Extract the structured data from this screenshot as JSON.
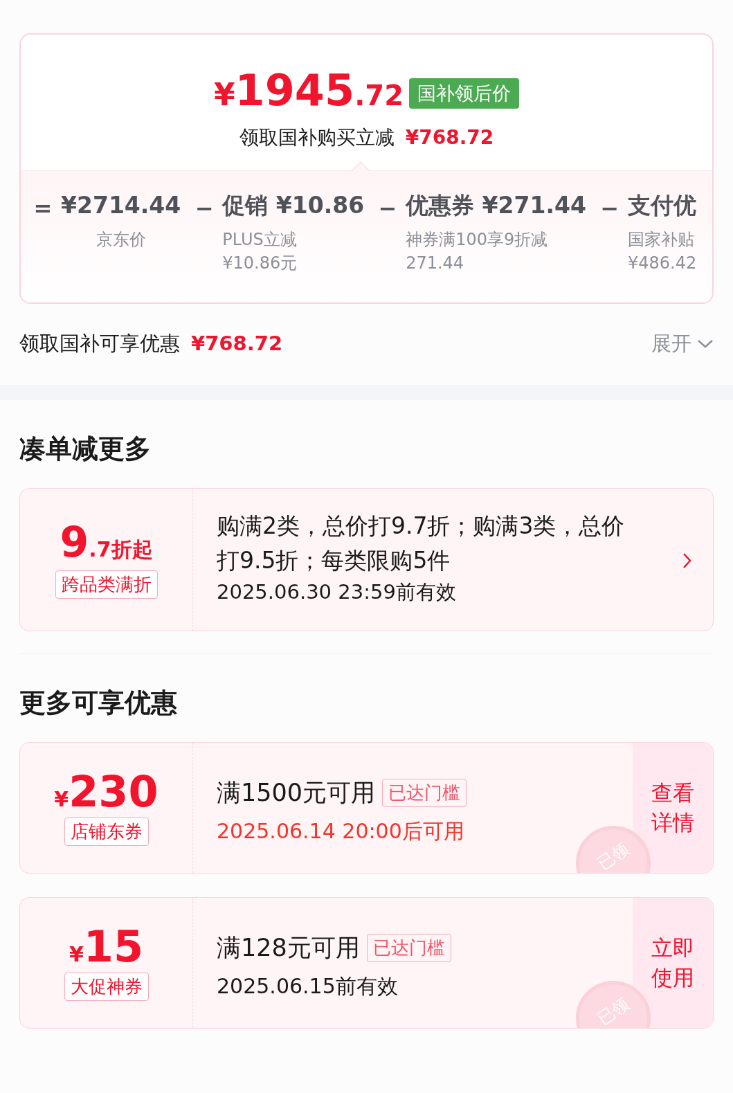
{
  "price_card": {
    "price_currency": "¥",
    "price_main": "1945",
    "price_decimal": ".72",
    "price_tag": "国补领后价",
    "savings_label": "领取国补购买立减",
    "savings_amount": "¥768.72",
    "breakdown": [
      {
        "operator": "=",
        "amount": "¥2714.44",
        "note_lines": [
          "京东价"
        ]
      },
      {
        "operator": "−",
        "amount": "促销 ¥10.86",
        "note_lines": [
          "PLUS立减",
          "¥10.86元"
        ]
      },
      {
        "operator": "−",
        "amount": "优惠券 ¥271.44",
        "note_lines": [
          "神券满100享9折减",
          "271.44"
        ]
      },
      {
        "operator": "−",
        "amount": "支付优",
        "note_lines": [
          "国家补贴",
          "¥486.42"
        ]
      }
    ]
  },
  "summary": {
    "label": "领取国补可享优惠",
    "amount": "¥768.72",
    "toggle": "展开",
    "expanded": false
  },
  "bundle_section": {
    "title": "凑单减更多",
    "offer": {
      "value_main": "9",
      "value_rest": ".7折起",
      "tag": "跨品类满折",
      "description": "购满2类，总价打9.7折；购满3类，总价打9.5折；每类限购5件",
      "validity": "2025.06.30 23:59前有效"
    }
  },
  "more_section": {
    "title": "更多可享优惠",
    "coupons": [
      {
        "currency": "¥",
        "amount": "230",
        "tag": "店铺东券",
        "condition": "满1500元可用",
        "badge": "已达门槛",
        "validity": "2025.06.14 20:00后可用",
        "validity_highlight": true,
        "action": "查看详情",
        "stamp": "已领"
      },
      {
        "currency": "¥",
        "amount": "15",
        "tag": "大促神券",
        "condition": "满128元可用",
        "badge": "已达门槛",
        "validity": "2025.06.15前有效",
        "validity_highlight": false,
        "action": "立即使用",
        "stamp": "已领"
      }
    ]
  }
}
